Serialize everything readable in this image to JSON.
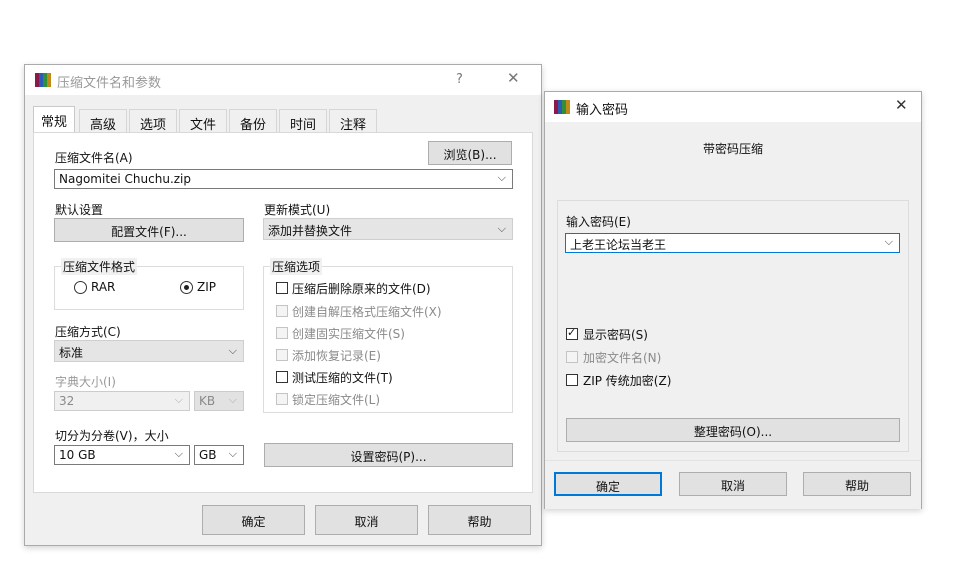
{
  "left_dialog": {
    "title": "压缩文件名和参数",
    "help_glyph": "?",
    "close_glyph": "✕",
    "tabs": [
      "常规",
      "高级",
      "选项",
      "文件",
      "备份",
      "时间",
      "注释"
    ],
    "archive_name_label": "压缩文件名(A)",
    "browse_label": "浏览(B)...",
    "archive_name_value": "Nagomitei Chuchu.zip",
    "default_settings_label": "默认设置",
    "profiles_label": "配置文件(F)...",
    "update_mode_label": "更新模式(U)",
    "update_mode_value": "添加并替换文件",
    "format_group_label": "压缩文件格式",
    "format_rar": "RAR",
    "format_zip": "ZIP",
    "options_group_label": "压缩选项",
    "options": [
      {
        "label": "压缩后删除原来的文件(D)",
        "enabled": true,
        "checked": false
      },
      {
        "label": "创建自解压格式压缩文件(X)",
        "enabled": false,
        "checked": false
      },
      {
        "label": "创建固实压缩文件(S)",
        "enabled": false,
        "checked": false
      },
      {
        "label": "添加恢复记录(E)",
        "enabled": false,
        "checked": false
      },
      {
        "label": "测试压缩的文件(T)",
        "enabled": true,
        "checked": false
      },
      {
        "label": "锁定压缩文件(L)",
        "enabled": false,
        "checked": false
      }
    ],
    "method_label": "压缩方式(C)",
    "method_value": "标准",
    "dict_size_label": "字典大小(I)",
    "dict_size_value": "32",
    "dict_unit_value": "KB",
    "split_label": "切分为分卷(V)，大小",
    "split_value": "10 GB",
    "split_unit_value": "GB",
    "set_password_label": "设置密码(P)...",
    "ok_label": "确定",
    "cancel_label": "取消",
    "help_label": "帮助"
  },
  "right_dialog": {
    "title": "输入密码",
    "close_glyph": "✕",
    "subtitle": "带密码压缩",
    "password_label": "输入密码(E)",
    "password_value": "上老王论坛当老王",
    "show_password_label": "显示密码(S)",
    "encrypt_names_label": "加密文件名(N)",
    "zip_legacy_label": "ZIP 传统加密(Z)",
    "organize_label": "整理密码(O)...",
    "ok_label": "确定",
    "cancel_label": "取消",
    "help_label": "帮助"
  },
  "icons": {
    "winrar_icon": "winrar-books-icon",
    "dropdown": "chevron-down-icon",
    "check": "checkmark-icon"
  },
  "colors": {
    "dialog_bg": "#f0f0f0",
    "titlebar_bg": "#ffffff",
    "button_bg": "#e1e1e1",
    "focus_border": "#0078d7"
  }
}
